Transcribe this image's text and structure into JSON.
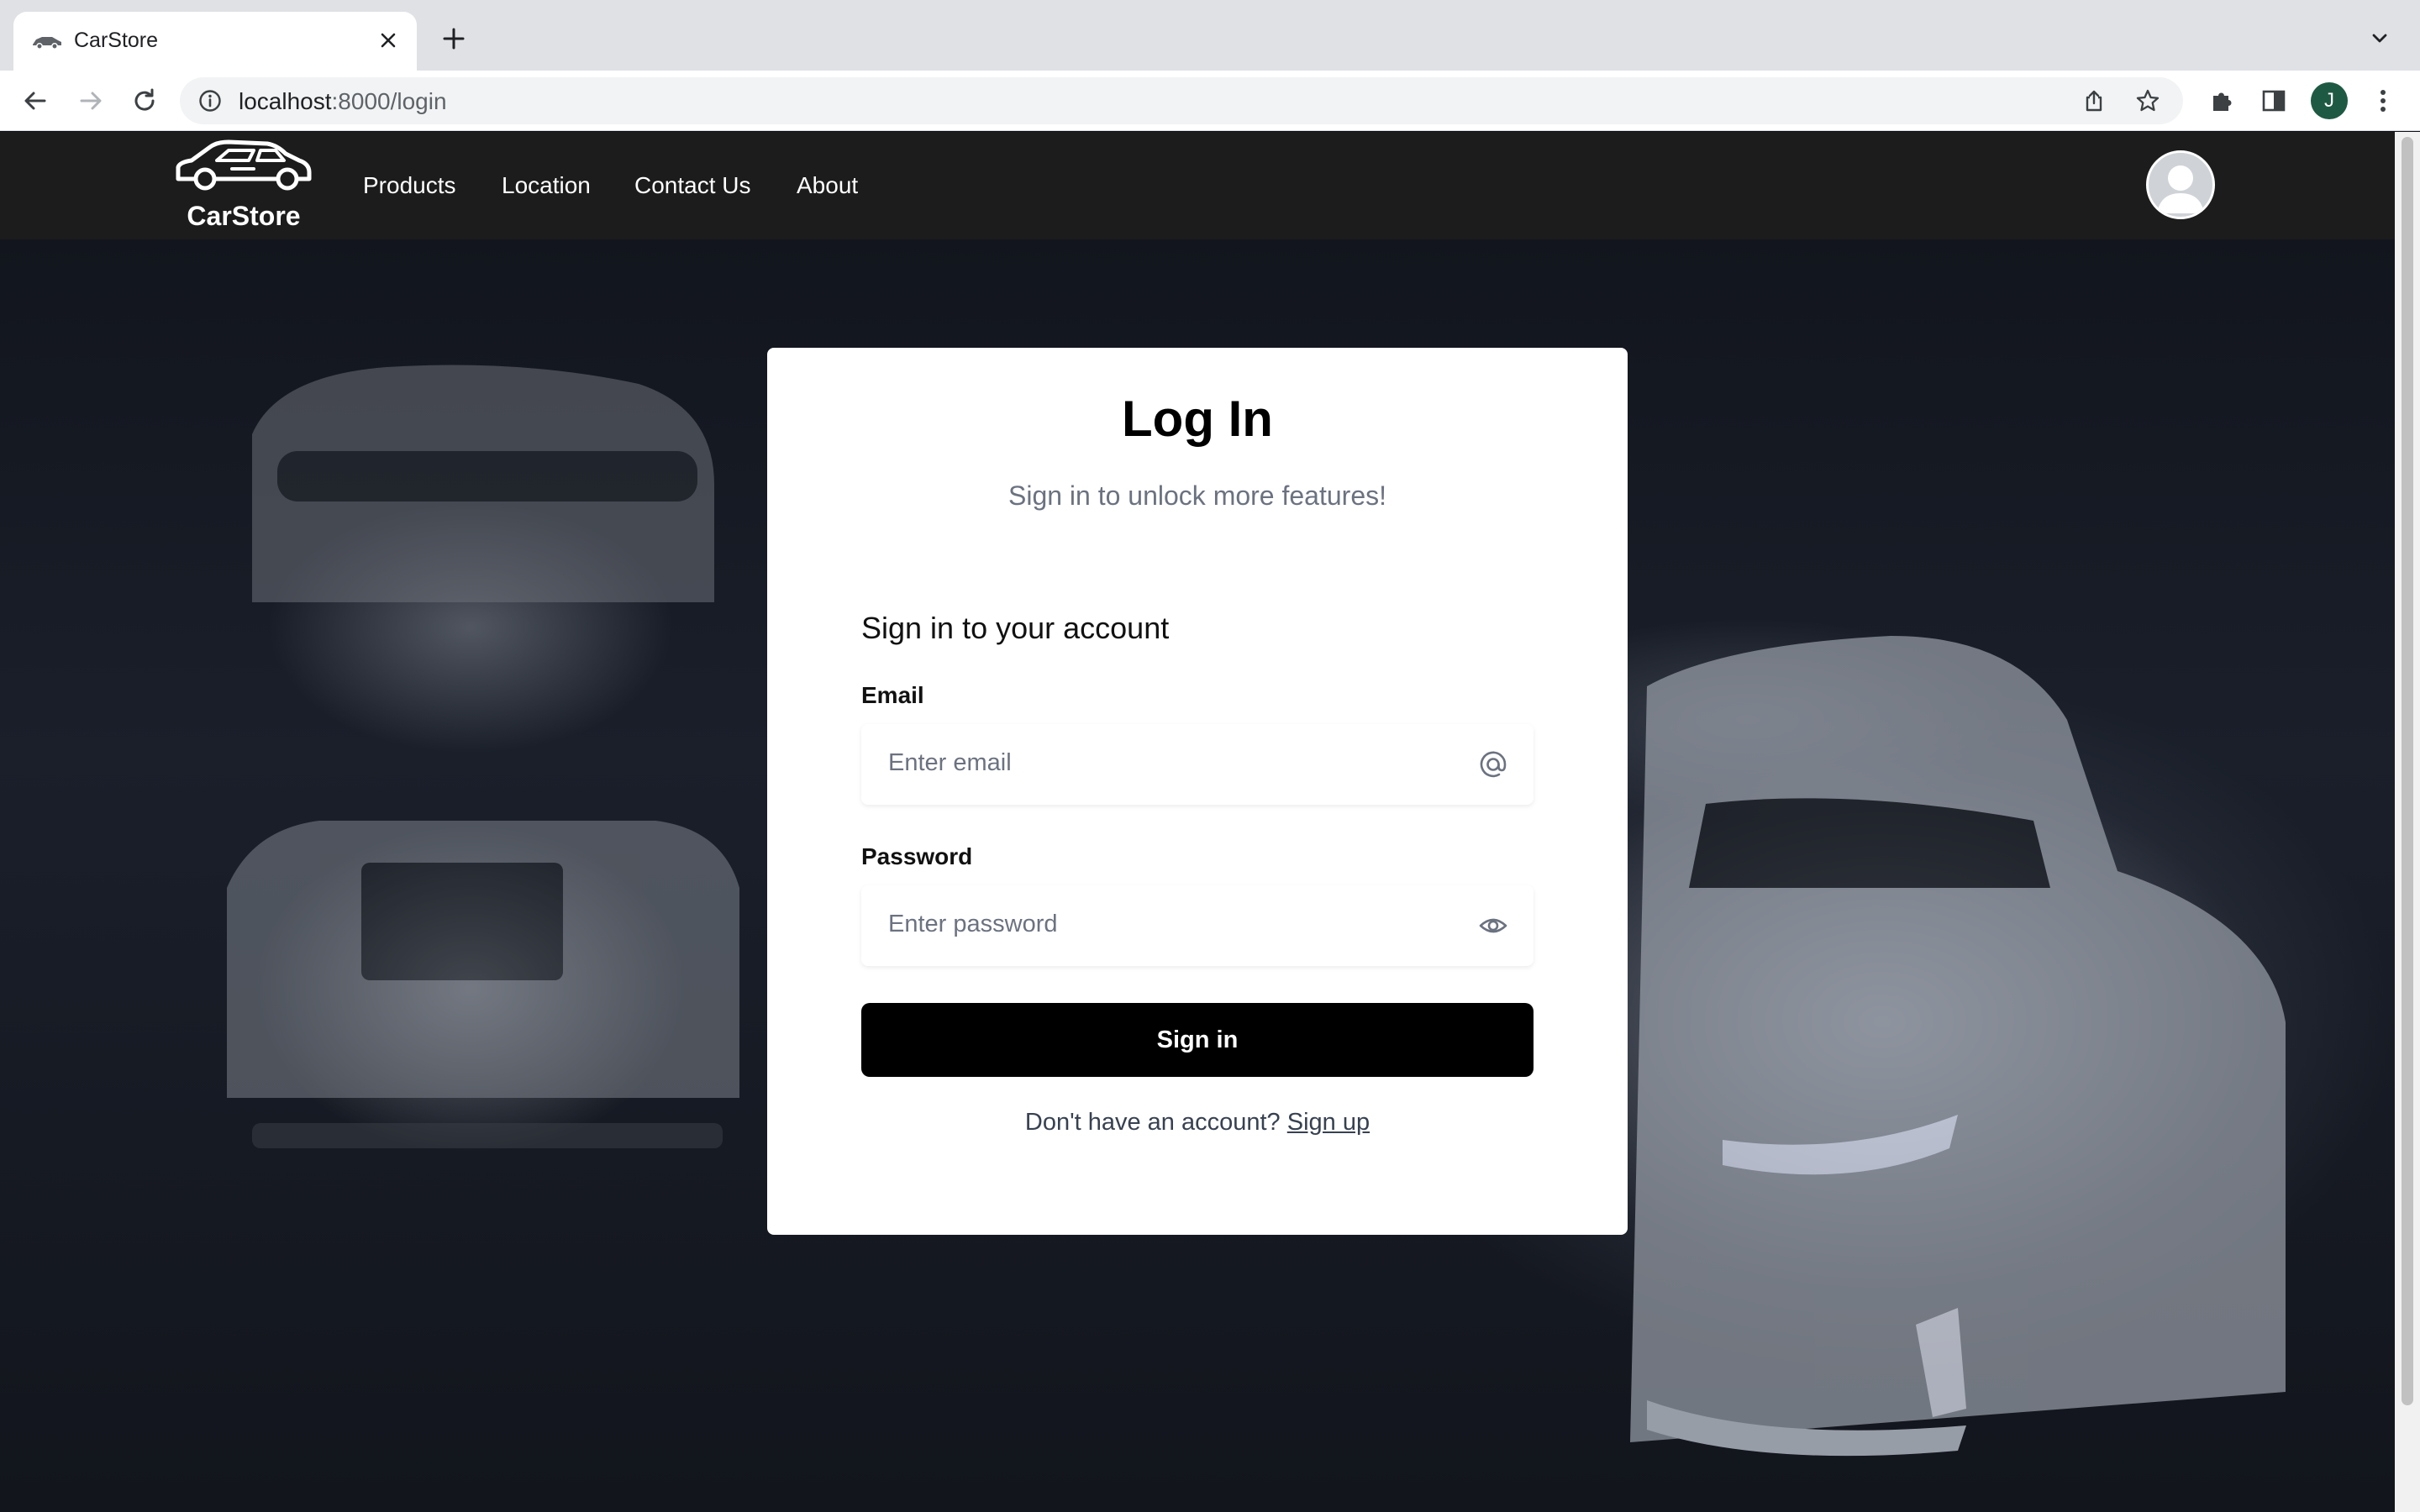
{
  "browser": {
    "tab_title": "CarStore",
    "url_host": "localhost",
    "url_path": ":8000/login",
    "profile_initial": "J"
  },
  "navbar": {
    "brand": "CarStore",
    "links": [
      "Products",
      "Location",
      "Contact Us",
      "About"
    ]
  },
  "login": {
    "title": "Log In",
    "subtitle": "Sign in to unlock more features!",
    "form_heading": "Sign in to your account",
    "email_label": "Email",
    "email_placeholder": "Enter email",
    "password_label": "Password",
    "password_placeholder": "Enter password",
    "submit_label": "Sign in",
    "signup_prompt": "Don't have an account?",
    "signup_link": "Sign up"
  },
  "icons": {
    "email_field_icon": "at-sign-icon",
    "password_field_icon": "eye-icon"
  },
  "colors": {
    "navbar_bg": "#1c1c1c",
    "button_bg": "#000000",
    "muted_text": "#6b7280",
    "profile_chip": "#1e5a43"
  }
}
